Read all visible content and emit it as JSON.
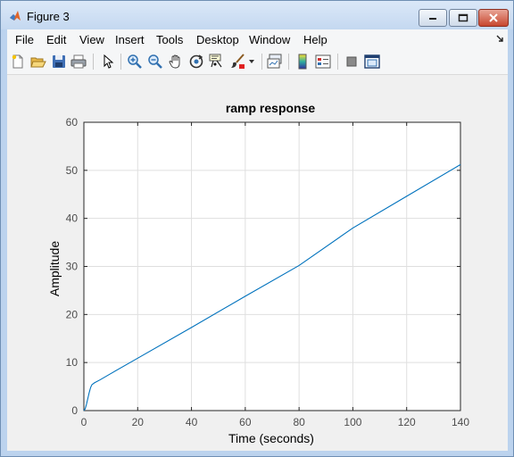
{
  "window": {
    "title": "Figure 3"
  },
  "menu": {
    "items": [
      {
        "label": "File"
      },
      {
        "label": "Edit"
      },
      {
        "label": "View"
      },
      {
        "label": "Insert"
      },
      {
        "label": "Tools"
      },
      {
        "label": "Desktop"
      },
      {
        "label": "Window"
      },
      {
        "label": "Help"
      }
    ]
  },
  "toolbar": {
    "icons": [
      "new-figure-icon",
      "open-file-icon",
      "save-icon",
      "print-icon",
      "pointer-icon",
      "zoom-in-icon",
      "zoom-out-icon",
      "pan-hand-icon",
      "rotate-3d-icon",
      "data-cursor-icon",
      "brush-icon",
      "brush-dropdown-icon",
      "link-plot-icon",
      "insert-colorbar-icon",
      "insert-legend-icon",
      "hide-plot-tools-icon",
      "show-plot-tools-icon"
    ]
  },
  "colors": {
    "line": "#0072bd",
    "grid": "#dfdfdf",
    "axes_bg": "#ffffff",
    "figure_bg": "#f0f0f0"
  },
  "chart_data": {
    "type": "line",
    "title": "ramp response",
    "xlabel": "Time (seconds)",
    "ylabel": "Amplitude",
    "xlim": [
      0,
      140
    ],
    "ylim": [
      0,
      60
    ],
    "xticks": [
      0,
      20,
      40,
      60,
      80,
      100,
      120,
      140
    ],
    "yticks": [
      0,
      10,
      20,
      30,
      40,
      50,
      60
    ],
    "grid": true,
    "series": [
      {
        "x": [
          0,
          0.5,
          1,
          1.5,
          2,
          2.5,
          3,
          4,
          6,
          10,
          20,
          40,
          60,
          80,
          100,
          120,
          140
        ],
        "y": [
          0,
          0.4,
          1.4,
          2.6,
          3.8,
          4.8,
          5.4,
          5.8,
          6.4,
          7.7,
          10.9,
          17.3,
          23.8,
          30.2,
          38.0,
          44.6,
          51.2
        ]
      }
    ]
  }
}
